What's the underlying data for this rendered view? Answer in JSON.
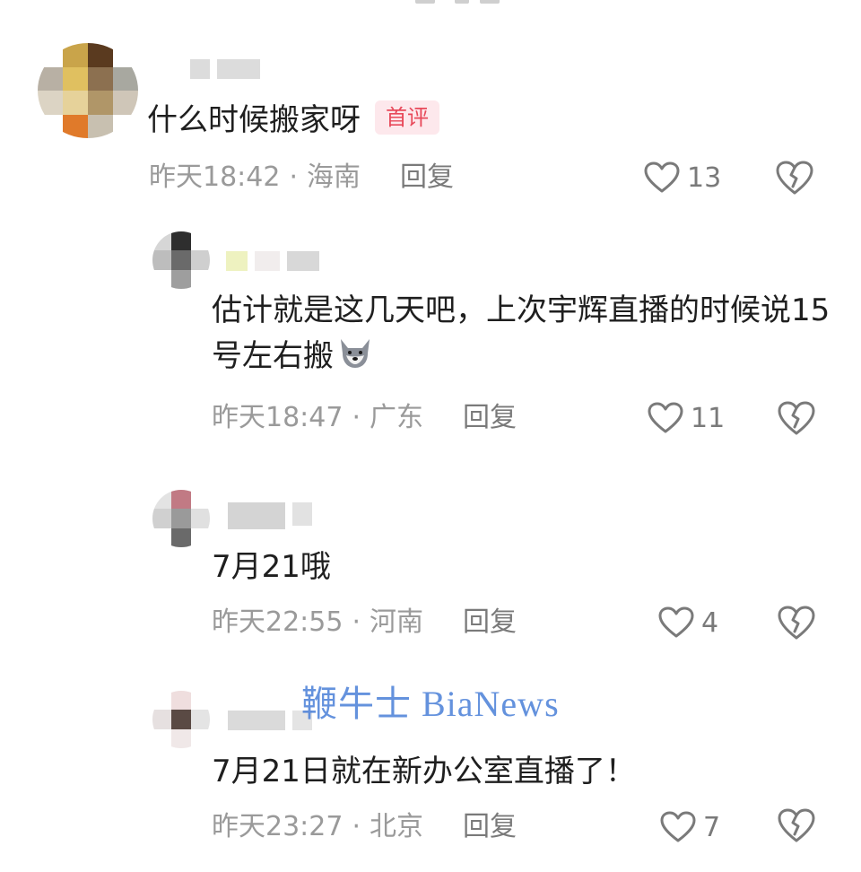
{
  "comments": [
    {
      "text": "什么时候搬家呀",
      "badge": "首评",
      "time": "昨天18:42",
      "location": "海南",
      "reply": "回复",
      "likes": "13"
    },
    {
      "text": "估计就是这几天吧，上次宇辉直播的时候说15号左右搬",
      "emoji": "wolf-emoji",
      "time": "昨天18:47",
      "location": "广东",
      "reply": "回复",
      "likes": "11"
    },
    {
      "text": "7月21哦",
      "time": "昨天22:55",
      "location": "河南",
      "reply": "回复",
      "likes": "4"
    },
    {
      "text": "7月21日就在新办公室直播了！",
      "time": "昨天23:27",
      "location": "北京",
      "reply": "回复",
      "likes": "7"
    }
  ],
  "watermark": "鞭牛士 BiaNews",
  "separator": "·",
  "icons": {
    "like": "heart-outline-icon",
    "dislike": "broken-heart-icon"
  },
  "colors": {
    "badge_text": "#e8495a",
    "badge_bg": "#fde8ec",
    "meta": "#9a9a9a",
    "watermark": "#4a7fd8"
  }
}
